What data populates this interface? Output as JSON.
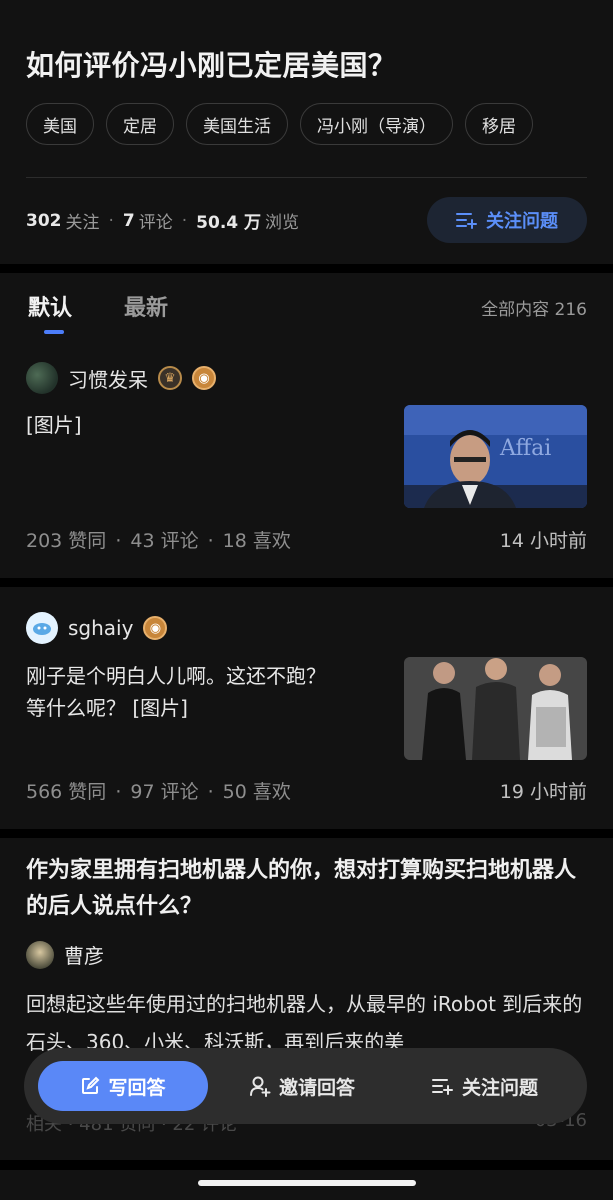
{
  "question": {
    "title": "如何评价冯小刚已定居美国？",
    "tags": [
      "美国",
      "定居",
      "美国生活",
      "冯小刚（导演）",
      "移居"
    ],
    "followers": "302",
    "followers_label": "关注",
    "comments": "7",
    "comments_label": "评论",
    "views": "50.4 万",
    "views_label": "浏览",
    "follow_button": "关注问题"
  },
  "answers_tabs": {
    "default": "默认",
    "latest": "最新",
    "all_content": "全部内容 216"
  },
  "answers": [
    {
      "author": "习惯发呆",
      "excerpt": "[图片]",
      "likes": "203 赞同",
      "comments": "43 评论",
      "favorites": "18 喜欢",
      "time": "14 小时前",
      "badges": [
        "crown-badge-icon",
        "eye-badge-icon"
      ],
      "thumbnail_text": "和国外交部 Affai"
    },
    {
      "author": "sghaiy",
      "excerpt_line1": "刚子是个明白人儿啊。这还不跑？",
      "excerpt_line2": "等什么呢？ [图片]",
      "likes": "566 赞同",
      "comments": "97 评论",
      "favorites": "50 喜欢",
      "time": "19 小时前",
      "badges": [
        "eye-badge-icon"
      ]
    }
  ],
  "recommendation": {
    "title": "作为家里拥有扫地机器人的你，想对打算购买扫地机器人的后人说点什么？",
    "author": "曹彦",
    "body": "回想起这些年使用过的扫地机器人，从最早的 iRobot 到后来的石头、360、小米、科沃斯，再到后来的美",
    "meta": "相关 · 481 赞同 · 22 评论",
    "time": "03-16"
  },
  "bottom_bar": {
    "write": "写回答",
    "invite": "邀请回答",
    "follow": "关注问题"
  },
  "colors": {
    "accent": "#5a88f7",
    "background": "#121212"
  }
}
